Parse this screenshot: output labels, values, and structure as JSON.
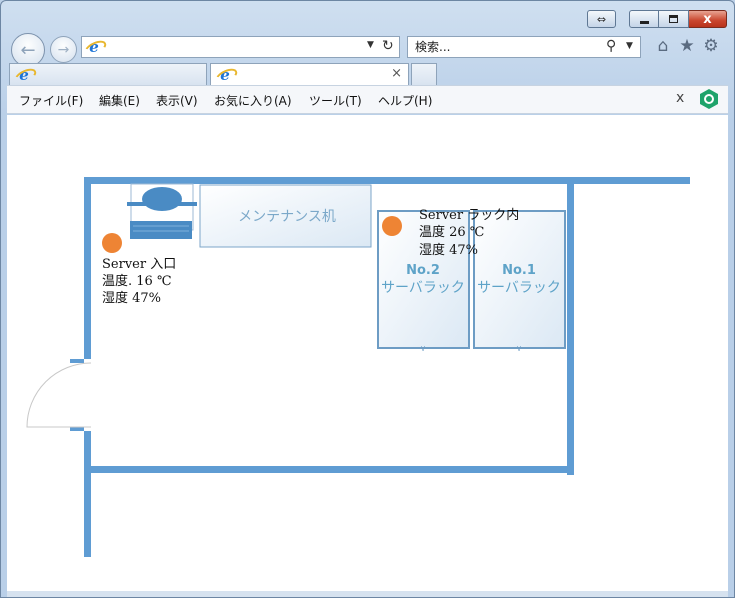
{
  "window": {
    "caption_buttons": {
      "restore": "⇔",
      "minimize": "",
      "maximize": "",
      "close": "x"
    }
  },
  "nav": {
    "back_icon": "arrow-left-icon",
    "forward_icon": "arrow-right-icon",
    "address_value": "",
    "search_placeholder": "検索..."
  },
  "tabs": [
    {
      "title": ""
    },
    {
      "title": "",
      "close": "×"
    }
  ],
  "menu": {
    "items": [
      "ファイル(F)",
      "編集(E)",
      "表示(V)",
      "お気に入り(A)",
      "ツール(T)",
      "ヘルプ(H)"
    ],
    "close_label": "x"
  },
  "floorplan": {
    "colors": {
      "wall": "#5f9cd3",
      "sensor": "#ee8434",
      "furniture_text": "#7ba8c9",
      "rack_text": "#5ea3c8"
    },
    "desk_label": "メンテナンス机",
    "racks": [
      {
        "number": "No.2",
        "label": "サーバラック"
      },
      {
        "number": "No.1",
        "label": "サーバラック"
      }
    ],
    "sensors": [
      {
        "title": "Server 入口",
        "temperature": "温度. 16 ℃",
        "humidity": "湿度 47%"
      },
      {
        "title": "Server ラック内",
        "temperature": "温度 26 ℃",
        "humidity": "湿度 47%"
      }
    ]
  }
}
